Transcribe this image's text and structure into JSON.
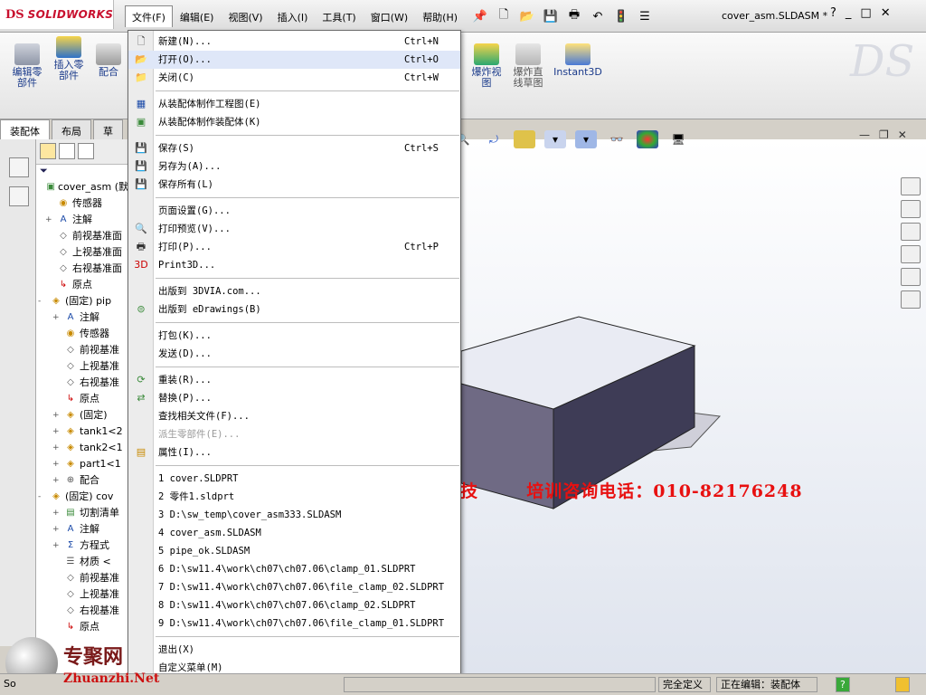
{
  "app": {
    "logo_mark": "DS",
    "logo_text": "SOLIDWORKS",
    "document_title": "cover_asm.SLDASM *",
    "help_label": "?",
    "window_controls": [
      "_",
      "□",
      "✕"
    ]
  },
  "menubar": [
    {
      "label": "文件(F)",
      "active": true
    },
    {
      "label": "编辑(E)"
    },
    {
      "label": "视图(V)"
    },
    {
      "label": "插入(I)"
    },
    {
      "label": "工具(T)"
    },
    {
      "label": "窗口(W)"
    },
    {
      "label": "帮助(H)"
    }
  ],
  "quick_access_icons": [
    "pin-icon",
    "new-doc-icon",
    "open-folder-icon",
    "save-icon",
    "print-icon",
    "undo-icon",
    "rebuild-icon",
    "options-icon"
  ],
  "command_manager": {
    "left": [
      {
        "label": "编辑零\n部件",
        "icon": "edit-part-icon"
      },
      {
        "label": "插入零\n部件",
        "icon": "insert-component-icon"
      },
      {
        "label": "配合",
        "icon": "mate-icon"
      }
    ],
    "right": [
      {
        "label": "爆炸视\n图",
        "icon": "exploded-view-icon"
      },
      {
        "label": "爆炸直\n线草图",
        "icon": "explode-line-sketch-icon"
      },
      {
        "label": "Instant3D",
        "icon": "instant3d-icon"
      }
    ]
  },
  "tabs": [
    {
      "label": "装配体",
      "active": true
    },
    {
      "label": "布局"
    },
    {
      "label": "草"
    }
  ],
  "feature_tree": [
    {
      "label": "cover_asm (默",
      "icon": "assembly-icon",
      "toggle": "",
      "indent": 0
    },
    {
      "label": "传感器",
      "icon": "sensor-icon",
      "toggle": "",
      "indent": 1
    },
    {
      "label": "注解",
      "icon": "annotation-icon",
      "toggle": "+",
      "indent": 1
    },
    {
      "label": "前视基准面",
      "icon": "plane-icon",
      "toggle": "",
      "indent": 1
    },
    {
      "label": "上视基准面",
      "icon": "plane-icon",
      "toggle": "",
      "indent": 1
    },
    {
      "label": "右视基准面",
      "icon": "plane-icon",
      "toggle": "",
      "indent": 1
    },
    {
      "label": "原点",
      "icon": "origin-icon",
      "toggle": "",
      "indent": 1
    },
    {
      "label": "(固定) pip",
      "icon": "part-icon",
      "toggle": "-",
      "indent": 0
    },
    {
      "label": "注解",
      "icon": "annotation-icon",
      "toggle": "+",
      "indent": 2
    },
    {
      "label": "传感器",
      "icon": "sensor-icon",
      "toggle": "",
      "indent": 2
    },
    {
      "label": "前视基准",
      "icon": "plane-icon",
      "toggle": "",
      "indent": 2
    },
    {
      "label": "上视基准",
      "icon": "plane-icon",
      "toggle": "",
      "indent": 2
    },
    {
      "label": "右视基准",
      "icon": "plane-icon",
      "toggle": "",
      "indent": 2
    },
    {
      "label": "原点",
      "icon": "origin-icon",
      "toggle": "",
      "indent": 2
    },
    {
      "label": "(固定)",
      "icon": "part-icon",
      "toggle": "+",
      "indent": 2
    },
    {
      "label": "tank1<2",
      "icon": "part-icon",
      "toggle": "+",
      "indent": 2
    },
    {
      "label": "tank2<1",
      "icon": "part-icon",
      "toggle": "+",
      "indent": 2
    },
    {
      "label": "part1<1",
      "icon": "part-icon",
      "toggle": "+",
      "indent": 2
    },
    {
      "label": "配合",
      "icon": "mate-icon",
      "toggle": "+",
      "indent": 2
    },
    {
      "label": "(固定) cov",
      "icon": "part-icon",
      "toggle": "-",
      "indent": 0
    },
    {
      "label": "切割清单",
      "icon": "cutlist-icon",
      "toggle": "+",
      "indent": 2
    },
    {
      "label": "注解",
      "icon": "annotation-icon",
      "toggle": "+",
      "indent": 2
    },
    {
      "label": "方程式",
      "icon": "equation-icon",
      "toggle": "+",
      "indent": 2
    },
    {
      "label": "材质 <",
      "icon": "material-icon",
      "toggle": "",
      "indent": 2
    },
    {
      "label": "前视基准",
      "icon": "plane-icon",
      "toggle": "",
      "indent": 2
    },
    {
      "label": "上视基准",
      "icon": "plane-icon",
      "toggle": "",
      "indent": 2
    },
    {
      "label": "右视基准",
      "icon": "plane-icon",
      "toggle": "",
      "indent": 2
    },
    {
      "label": "原点",
      "icon": "origin-icon",
      "toggle": "",
      "indent": 2
    }
  ],
  "file_menu": [
    {
      "label": "新建(N)...",
      "shortcut": "Ctrl+N",
      "icon": "new-doc-icon"
    },
    {
      "label": "打开(O)...",
      "shortcut": "Ctrl+O",
      "icon": "open-folder-icon",
      "hover": true
    },
    {
      "label": "关闭(C)",
      "shortcut": "Ctrl+W",
      "icon": "close-doc-icon"
    },
    {
      "sep": true
    },
    {
      "label": "从装配体制作工程图(E)",
      "icon": "make-drawing-icon"
    },
    {
      "label": "从装配体制作装配体(K)",
      "icon": "make-assembly-icon"
    },
    {
      "sep": true
    },
    {
      "label": "保存(S)",
      "shortcut": "Ctrl+S",
      "icon": "save-icon"
    },
    {
      "label": "另存为(A)...",
      "icon": "save-as-icon"
    },
    {
      "label": "保存所有(L)",
      "icon": "save-all-icon"
    },
    {
      "sep": true
    },
    {
      "label": "页面设置(G)...",
      "icon": ""
    },
    {
      "label": "打印预览(V)...",
      "icon": "print-preview-icon"
    },
    {
      "label": "打印(P)...",
      "shortcut": "Ctrl+P",
      "icon": "print-icon"
    },
    {
      "label": "Print3D...",
      "icon": "print3d-icon"
    },
    {
      "sep": true
    },
    {
      "label": "出版到 3DVIA.com...",
      "icon": ""
    },
    {
      "label": "出版到 eDrawings(B)",
      "icon": "edrawings-icon"
    },
    {
      "sep": true
    },
    {
      "label": "打包(K)...",
      "icon": ""
    },
    {
      "label": "发送(D)...",
      "icon": ""
    },
    {
      "sep": true
    },
    {
      "label": "重装(R)...",
      "icon": "reload-icon"
    },
    {
      "label": "替换(P)...",
      "icon": "replace-icon"
    },
    {
      "label": "查找相关文件(F)...",
      "icon": ""
    },
    {
      "label": "派生零部件(E)...",
      "icon": "",
      "disabled": true
    },
    {
      "label": "属性(I)...",
      "icon": "properties-icon"
    },
    {
      "sep": true
    },
    {
      "label": "1 cover.SLDPRT",
      "icon": ""
    },
    {
      "label": "2 零件1.sldprt",
      "icon": ""
    },
    {
      "label": "3 D:\\sw_temp\\cover_asm333.SLDASM",
      "icon": ""
    },
    {
      "label": "4 cover_asm.SLDASM",
      "icon": ""
    },
    {
      "label": "5 pipe_ok.SLDASM",
      "icon": ""
    },
    {
      "label": "6 D:\\sw11.4\\work\\ch07\\ch07.06\\clamp_01.SLDPRT",
      "icon": ""
    },
    {
      "label": "7 D:\\sw11.4\\work\\ch07\\ch07.06\\file_clamp_02.SLDPRT",
      "icon": ""
    },
    {
      "label": "8 D:\\sw11.4\\work\\ch07\\ch07.06\\clamp_02.SLDPRT",
      "icon": ""
    },
    {
      "label": "9 D:\\sw11.4\\work\\ch07\\ch07.06\\file_clamp_01.SLDPRT",
      "icon": ""
    },
    {
      "sep": true
    },
    {
      "label": "退出(X)",
      "icon": ""
    },
    {
      "label": "自定义菜单(M)",
      "icon": ""
    }
  ],
  "overlay_text": {
    "company": "兆迪科技",
    "hotline": "培训咨询电话：010-82176248",
    "watermark_logo": "专聚网",
    "watermark_url": "Zhuanzhi.Net"
  },
  "status": {
    "left": "So",
    "fully_defined": "完全定义",
    "editing": "正在编辑：装配体",
    "help_icon_label": "?"
  },
  "colors": {
    "menu_hover": "#dfe7f8",
    "box_top": "#e9ebf3",
    "box_front": "#6f6a84",
    "box_side": "#3e3c56",
    "plate": "#cfcfd9",
    "ad_red": "#e81010"
  }
}
